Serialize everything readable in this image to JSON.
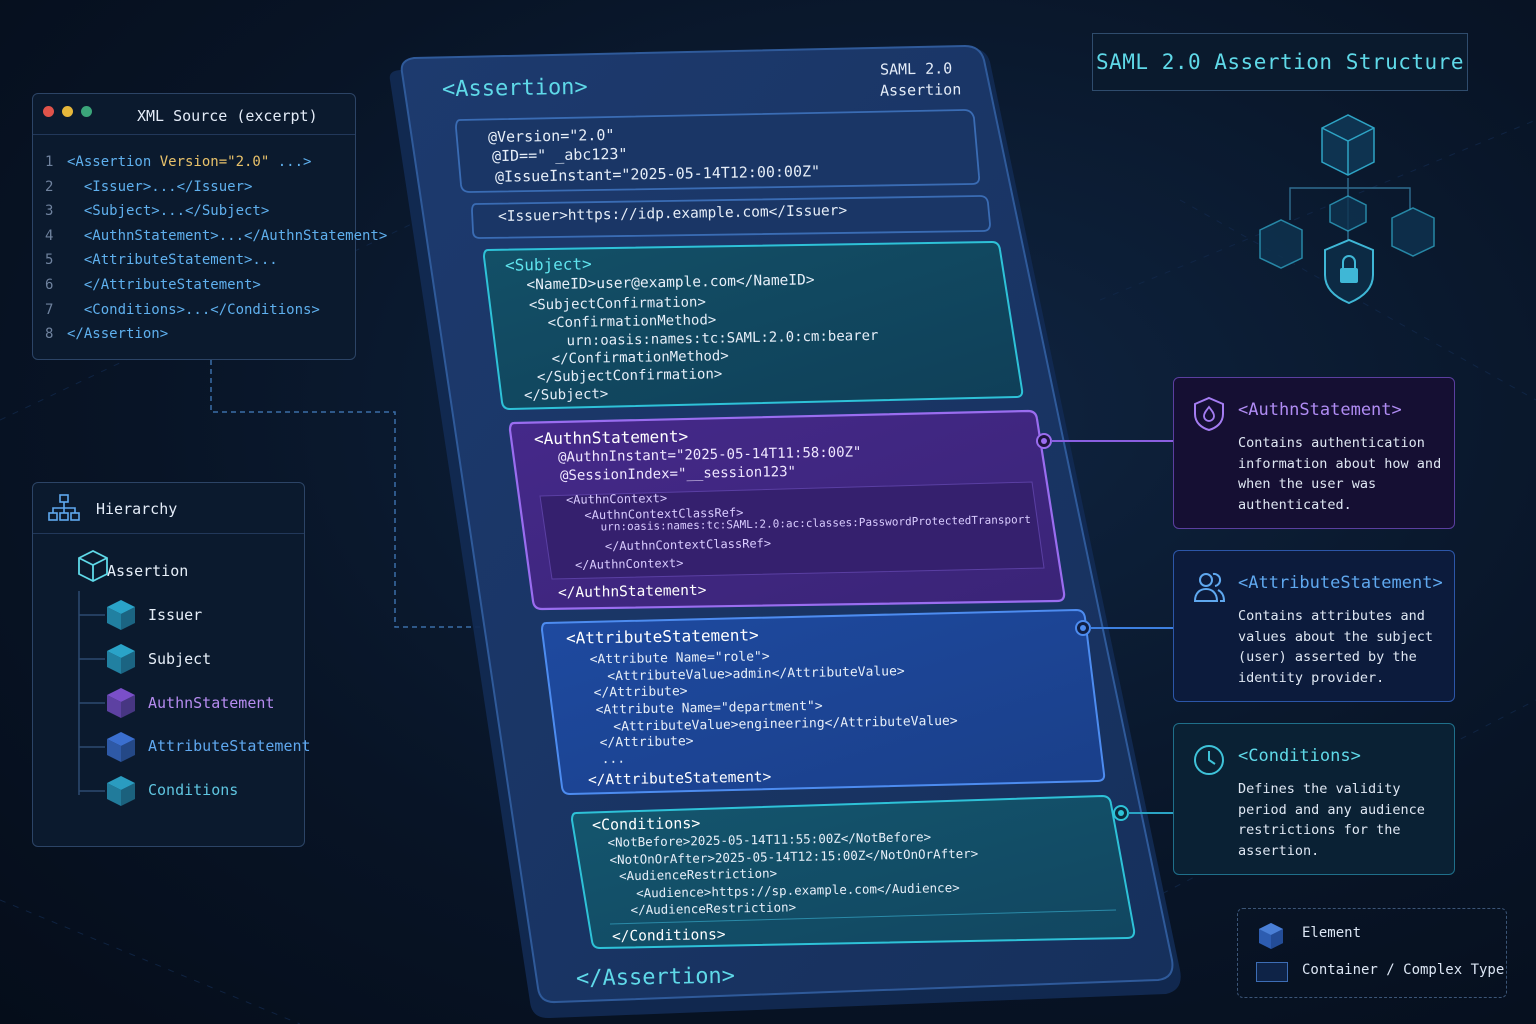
{
  "title": "SAML 2.0 Assertion Structure",
  "xml_panel": {
    "title": "XML Source (excerpt)",
    "lines": [
      {
        "num": "1",
        "pre": "<Assertion ",
        "attr": "Version=\"2.0\"",
        "post": " ...>"
      },
      {
        "num": "2",
        "pre": "  <Issuer>...</Issuer>",
        "attr": "",
        "post": ""
      },
      {
        "num": "3",
        "pre": "  <Subject>...</Subject>",
        "attr": "",
        "post": ""
      },
      {
        "num": "4",
        "pre": "  <AuthnStatement>...</AuthnStatement>",
        "attr": "",
        "post": ""
      },
      {
        "num": "5",
        "pre": "  <AttributeStatement>...",
        "attr": "",
        "post": ""
      },
      {
        "num": "6",
        "pre": "  </AttributeStatement>",
        "attr": "",
        "post": ""
      },
      {
        "num": "7",
        "pre": "  <Conditions>...</Conditions>",
        "attr": "",
        "post": ""
      },
      {
        "num": "8",
        "pre": "</Assertion>",
        "attr": "",
        "post": ""
      }
    ]
  },
  "hierarchy": {
    "title": "Hierarchy",
    "root": "Assertion",
    "children": [
      {
        "label": "Issuer",
        "color": "#e6eef8",
        "cube": "#2aa3c8"
      },
      {
        "label": "Subject",
        "color": "#e6eef8",
        "cube": "#2aa3c8"
      },
      {
        "label": "AuthnStatement",
        "color": "#b68cf0",
        "cube": "#7a4fc9"
      },
      {
        "label": "AttributeStatement",
        "color": "#5fa8ef",
        "cube": "#3b6fcf"
      },
      {
        "label": "Conditions",
        "color": "#5fc5e0",
        "cube": "#2a9cc0"
      }
    ]
  },
  "stack": {
    "header": "<Assertion>",
    "footer": "</Assertion>",
    "badge_line1": "SAML 2.0",
    "badge_line2": "Assertion",
    "attrs": [
      "@Version=\"2.0\"",
      "@ID==\" _abc123\"",
      "@IssueInstant=\"2025-05-14T12:00:00Z\""
    ],
    "issuer": "<Issuer>https://idp.example.com</Issuer>",
    "subject": [
      "<Subject>",
      "  <NameID>user@example.com</NameID>",
      "  <SubjectConfirmation>",
      "    <ConfirmationMethod>",
      "      urn:oasis:names:tc:SAML:2.0:cm:bearer",
      "    </ConfirmationMethod>",
      "  </SubjectConfirmation>",
      "</Subject>"
    ],
    "authn": {
      "open": "<AuthnStatement>",
      "attrs": [
        "@AuthnInstant=\"2025-05-14T11:58:00Z\"",
        "@SessionIndex=\"__session123\""
      ],
      "context": [
        "<AuthnContext>",
        "  <AuthnContextClassRef>",
        "    urn:oasis:names:tc:SAML:2.0:ac:classes:PasswordProtectedTransport",
        "    </AuthnContextClassRef>",
        "</AuthnContext>"
      ],
      "close": "</AuthnStatement>"
    },
    "attribute": [
      "<AttributeStatement>",
      "  <Attribute Name=\"role\">",
      "    <AttributeValue>admin</AttributeValue>",
      "  </Attribute>",
      "  <Attribute Name=\"department\">",
      "    <AttributeValue>engineering</AttributeValue>",
      "  </Attribute>",
      "  ...",
      "</AttributeStatement>"
    ],
    "conditions": [
      "<Conditions>",
      " <NotBefore>2025-05-14T11:55:00Z</NotBefore>",
      " <NotOnOrAfter>2025-05-14T12:15:00Z</NotOnOrAfter>",
      "  <AudienceRestriction>",
      "    <Audience>https://sp.example.com</Audience>",
      "   </AudienceRestriction>",
      "</Conditions>"
    ]
  },
  "cards": {
    "authn": {
      "title": "<AuthnStatement>",
      "desc": "Contains authentication information about how and when the user was authenticated."
    },
    "attribute": {
      "title": "<AttributeStatement>",
      "desc": "Contains attributes and values about the subject (user) asserted by the identity provider."
    },
    "conditions": {
      "title": "<Conditions>",
      "desc": "Defines the validity period and any audience restrictions for the assertion."
    }
  },
  "legend": {
    "element": "Element",
    "container": "Container / Complex Type"
  },
  "colors": {
    "teal": "#5fd9e8",
    "purple": "#8f5fe8",
    "blue": "#3d7fe0"
  }
}
